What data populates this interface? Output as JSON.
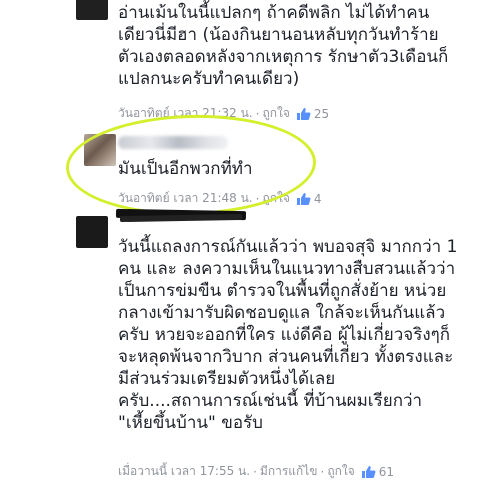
{
  "comments": [
    {
      "body": "อ่านเม้นในนี้แปลกๆ ถ้าคดีพลิก ไม่ได้ทำคน\nเดียวนี่มีฮา (น้องกินยานอนหลับทุกวันทำร้าย\nตัวเองตลอดหลังจากเหตุการ รักษาตัว3เดือนก็\nแปลกนะครับทำคนเดียว)",
      "meta": {
        "time": "วันอาทิตย์ เวลา 21:32 น.",
        "like": "ถูกใจ",
        "count": "25"
      }
    },
    {
      "body": "มันเป็นอีกพวกที่ทำ",
      "meta": {
        "time": "วันอาทิตย์ เวลา 21:48 น.",
        "like": "ถูกใจ",
        "count": "4"
      }
    },
    {
      "body": "วันนี้แถลงการณ์กันแล้วว่า พบอจสุจิ มากกว่า 1\nคน และ ลงความเห็นในแนวทางสืบสวนแล้วว่า\nเป็นการข่มขืน ตำรวจในพื้นที่ถูกสั่งย้าย หน่วย\nกลางเข้ามารับผิดชอบดูแล ใกล้จะเห็นกันแล้ว\nครับ หวยจะออกที่ใคร แง่ดีคือ ผู้ไม่เกี่ยวจริงๆก็\nจะหลุดพ้นจากวิบาก ส่วนคนที่เกี่ยว ทั้งตรงและ\nมีส่วนร่วมเตรียมตัวหนึ่งได้เลย\nครับ....สถานการณ์เช่นนี้ ที่บ้านผมเรียกว่า\n\"เหี้ยขึ้นบ้าน\" ขอรับ",
      "meta": {
        "time": "เมื่อวานนี้ เวลา 17:55 น.",
        "edited": "มีการแก้ไข",
        "like": "ถูกใจ",
        "count": "61"
      }
    }
  ],
  "colors": {
    "like_icon": "#5890ff",
    "highlight": "#d4ef2c",
    "text": "#1d2129",
    "meta": "#90949c"
  },
  "icons": {
    "like": "thumbs-up-icon"
  }
}
